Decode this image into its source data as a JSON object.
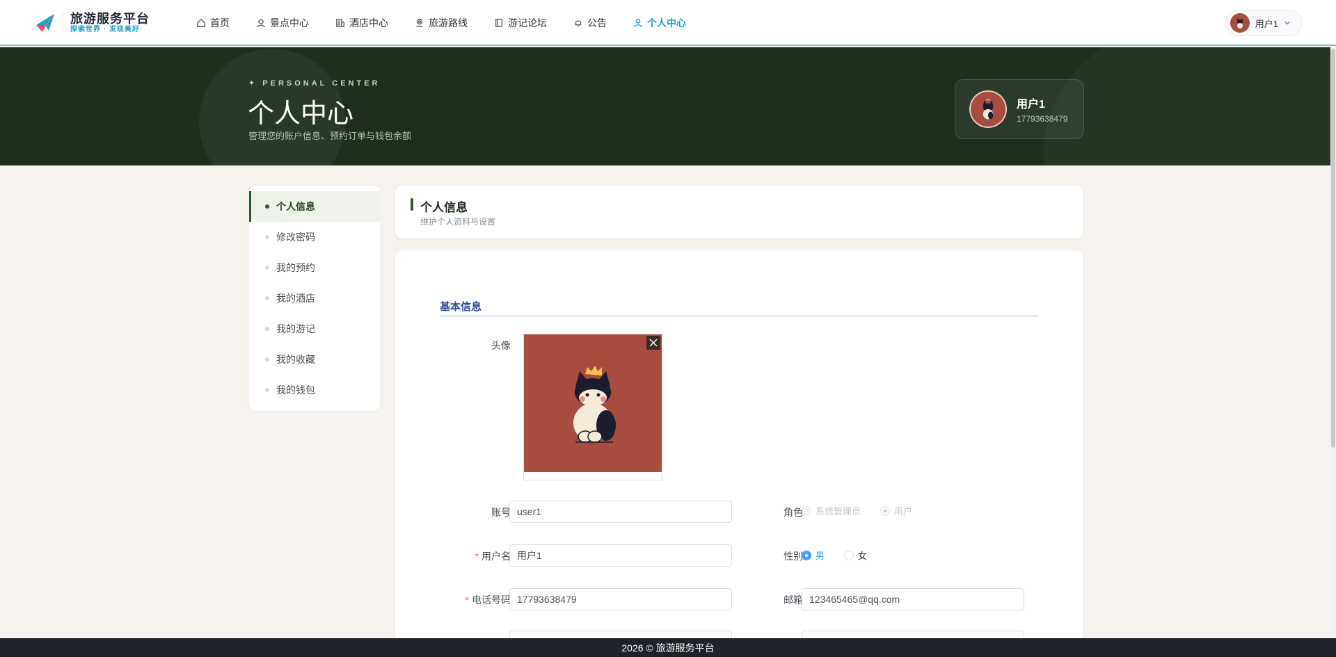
{
  "app": {
    "title": "旅游服务平台",
    "subtitle": "探索世界 · 发现美好"
  },
  "nav": {
    "items": [
      {
        "label": "首页",
        "icon": "home-icon"
      },
      {
        "label": "景点中心",
        "icon": "location-icon"
      },
      {
        "label": "酒店中心",
        "icon": "building-icon"
      },
      {
        "label": "旅游路线",
        "icon": "map-pin-icon"
      },
      {
        "label": "游记论坛",
        "icon": "book-icon"
      },
      {
        "label": "公告",
        "icon": "bell-icon"
      },
      {
        "label": "个人中心",
        "icon": "user-icon",
        "active": true
      }
    ],
    "active_color": "#1aa3c4"
  },
  "user": {
    "name": "用户1",
    "phone": "17793638479"
  },
  "banner": {
    "eyebrow": "✦ PERSONAL CENTER",
    "title": "个人中心",
    "description": "管理您的账户信息、预约订单与钱包余额",
    "bg_color": "#1e2f1e"
  },
  "sidebar": {
    "items": [
      {
        "label": "个人信息",
        "active": true
      },
      {
        "label": "修改密码"
      },
      {
        "label": "我的预约"
      },
      {
        "label": "我的酒店"
      },
      {
        "label": "我的游记"
      },
      {
        "label": "我的收藏"
      },
      {
        "label": "我的钱包"
      }
    ]
  },
  "section": {
    "title": "个人信息",
    "subtitle": "维护个人资料与设置"
  },
  "form": {
    "group_title": "基本信息",
    "avatar_label": "头像",
    "account": {
      "label": "账号",
      "value": "user1"
    },
    "role": {
      "label": "角色",
      "options": [
        "系统管理员",
        "用户"
      ],
      "selected": "用户"
    },
    "username": {
      "label": "用户名",
      "value": "用户1",
      "required": true
    },
    "gender": {
      "label": "性别",
      "options": [
        "男",
        "女"
      ],
      "selected": "男"
    },
    "phone": {
      "label": "电话号码",
      "value": "17793638479",
      "required": true
    },
    "email": {
      "label": "邮箱",
      "value": "123465465@qq.com"
    }
  },
  "footer": {
    "text": "2026 © 旅游服务平台"
  }
}
